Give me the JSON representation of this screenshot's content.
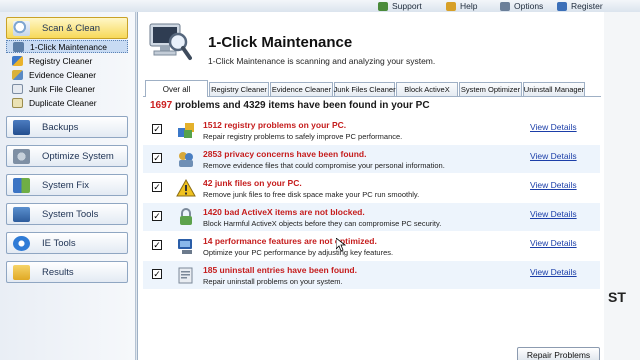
{
  "topbar": {
    "items": [
      {
        "label": "Support",
        "icon": "support-icon"
      },
      {
        "label": "Help",
        "icon": "help-icon"
      },
      {
        "label": "Options",
        "icon": "options-icon"
      },
      {
        "label": "Register",
        "icon": "register-icon"
      }
    ]
  },
  "sidebar": {
    "categories": [
      {
        "label": "Scan & Clean",
        "icon": "magnifier-icon"
      },
      {
        "label": "Backups",
        "icon": "backups-icon"
      },
      {
        "label": "Optimize System",
        "icon": "optimize-icon"
      },
      {
        "label": "System Fix",
        "icon": "system-fix-icon"
      },
      {
        "label": "System Tools",
        "icon": "tools-icon"
      },
      {
        "label": "IE Tools",
        "icon": "ie-icon"
      },
      {
        "label": "Results",
        "icon": "results-folder-icon"
      }
    ],
    "scan_items": [
      {
        "label": "1-Click Maintenance",
        "icon": "maintenance-icon"
      },
      {
        "label": "Registry Cleaner",
        "icon": "registry-icon"
      },
      {
        "label": "Evidence Cleaner",
        "icon": "evidence-icon"
      },
      {
        "label": "Junk  File Cleaner",
        "icon": "junk-icon"
      },
      {
        "label": "Duplicate Cleaner",
        "icon": "duplicate-icon"
      }
    ]
  },
  "header": {
    "title": "1-Click Maintenance",
    "subtitle": "1-Click Maintenance is scanning and analyzing your system."
  },
  "tabs": [
    {
      "label": "Over all"
    },
    {
      "label": "Registry Cleaner"
    },
    {
      "label": "Evidence Cleaner"
    },
    {
      "label": "Junk Files Cleaner"
    },
    {
      "label": "Block ActiveX"
    },
    {
      "label": "System Optimizer"
    },
    {
      "label": "Uninstall Manager"
    }
  ],
  "summary": {
    "problem_count": "1697",
    "text": "problems and 4329 items have been found in your PC"
  },
  "results": [
    {
      "title": "1512 registry problems on your PC.",
      "desc": "Repair registry problems to safely improve PC performance.",
      "link": "View Details",
      "checked": true,
      "icon": "registry-result-icon"
    },
    {
      "title": "2853 privacy concerns have been found.",
      "desc": "Remove evidence files that could compromise your personal information.",
      "link": "View Details",
      "checked": true,
      "icon": "privacy-icon"
    },
    {
      "title": "42 junk files on your PC.",
      "desc": "Remove junk files to free disk space make your PC run smoothly.",
      "link": "View Details",
      "checked": true,
      "icon": "warning-icon"
    },
    {
      "title": "1420 bad ActiveX items are not blocked.",
      "desc": "Block Harmful ActiveX objects before they can compromise PC security.",
      "link": "View Details",
      "checked": true,
      "icon": "activex-lock-icon"
    },
    {
      "title": "14 performance features are not optimized.",
      "desc": "Optimize your PC performance by adjusting key features.",
      "link": "View Details",
      "checked": true,
      "icon": "performance-icon"
    },
    {
      "title": "185 uninstall entries have been found.",
      "desc": "Repair uninstall problems on your system.",
      "link": "View Details",
      "checked": true,
      "icon": "uninstall-icon"
    }
  ],
  "actions": {
    "repair_label": "Repair Problems"
  },
  "overlay_text": "ST",
  "colors": {
    "alert_red": "#c51c1c",
    "link_blue": "#1b3ea8",
    "active_category": "#f7d95a",
    "row_alt": "#edf4fc"
  }
}
